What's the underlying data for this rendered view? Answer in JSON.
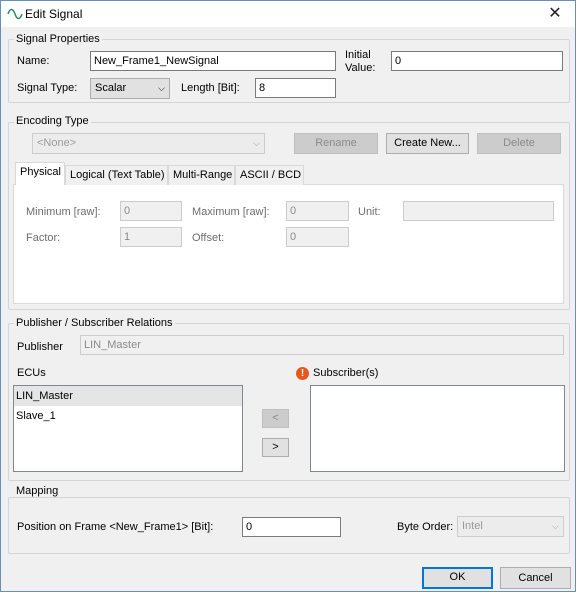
{
  "window": {
    "title": "Edit Signal",
    "close_glyph": "✕",
    "icon": "sine-wave-icon"
  },
  "signal_properties": {
    "title": "Signal Properties",
    "name_label": "Name:",
    "name_value": "New_Frame1_NewSignal",
    "initial_value_label_line1": "Initial",
    "initial_value_label_line2": "Value:",
    "initial_value": "0",
    "signal_type_label": "Signal Type:",
    "signal_type_value": "Scalar",
    "length_label": "Length [Bit]:",
    "length_value": "8"
  },
  "encoding_type": {
    "title": "Encoding Type",
    "selected": "<None>",
    "rename_label": "Rename",
    "create_new_label": "Create New...",
    "delete_label": "Delete"
  },
  "tabs": [
    {
      "label": "Physical",
      "active": true
    },
    {
      "label": "Logical (Text Table)",
      "active": false
    },
    {
      "label": "Multi-Range",
      "active": false
    },
    {
      "label": "ASCII / BCD",
      "active": false
    }
  ],
  "physical": {
    "minimum_label": "Minimum [raw]:",
    "minimum_value": "0",
    "maximum_label": "Maximum [raw]:",
    "maximum_value": "0",
    "unit_label": "Unit:",
    "unit_value": "",
    "factor_label": "Factor:",
    "factor_value": "1",
    "offset_label": "Offset:",
    "offset_value": "0"
  },
  "relations": {
    "title": "Publisher / Subscriber Relations",
    "publisher_label": "Publisher",
    "publisher_value": "LIN_Master",
    "ecus_label": "ECUs",
    "ecus": [
      "LIN_Master",
      "Slave_1"
    ],
    "subscribers_label": "Subscriber(s)",
    "subscribers": [],
    "move_left_label": "<",
    "move_right_label": ">",
    "warning_glyph": "!"
  },
  "mapping": {
    "title": "Mapping",
    "position_label": "Position on Frame <New_Frame1> [Bit]:",
    "position_value": "0",
    "byte_order_label": "Byte Order:",
    "byte_order_value": "Intel"
  },
  "footer": {
    "ok_label": "OK",
    "cancel_label": "Cancel"
  }
}
